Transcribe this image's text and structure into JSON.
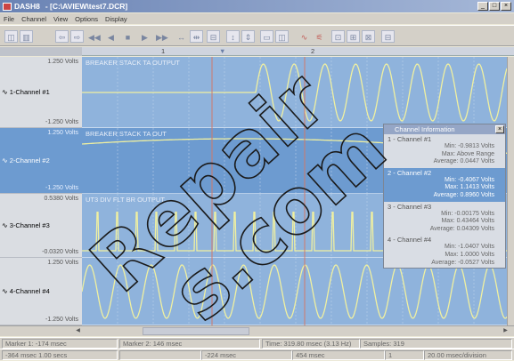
{
  "window": {
    "app_name": "DASH8",
    "document_path": "- [C:\\AVIEW\\test7.DCR]",
    "buttons": {
      "minimize": "_",
      "maximize": "□",
      "close": "×"
    }
  },
  "menu": [
    "File",
    "Channel",
    "View",
    "Options",
    "Display"
  ],
  "toolbar": [
    {
      "name": "marker-icon",
      "glyph": "◫"
    },
    {
      "name": "grid-icon",
      "glyph": "▥"
    },
    {
      "name": "scroll-left-icon",
      "glyph": "⇦"
    },
    {
      "name": "scroll-right-icon",
      "glyph": "⇨"
    },
    {
      "name": "rewind-icon",
      "glyph": "◀◀"
    },
    {
      "name": "step-back-icon",
      "glyph": "◀"
    },
    {
      "name": "stop-icon",
      "glyph": "■"
    },
    {
      "name": "play-icon",
      "glyph": "▶"
    },
    {
      "name": "fast-forward-icon",
      "glyph": "▶▶"
    },
    {
      "name": "zoom-time-out-icon",
      "glyph": "↔"
    },
    {
      "name": "zoom-time-in-icon",
      "glyph": "⇹"
    },
    {
      "name": "fit-icon",
      "glyph": "⊟"
    },
    {
      "name": "zoom-amp-out-icon",
      "glyph": "↕"
    },
    {
      "name": "zoom-amp-in-icon",
      "glyph": "⇕"
    },
    {
      "name": "window-single-icon",
      "glyph": "▭"
    },
    {
      "name": "window-split-icon",
      "glyph": "◫"
    },
    {
      "name": "waveform-icon",
      "glyph": "∿"
    },
    {
      "name": "filter-icon",
      "glyph": "⚟"
    },
    {
      "name": "export-icon",
      "glyph": "⊡"
    },
    {
      "name": "print-icon",
      "glyph": "⊞"
    },
    {
      "name": "copy-icon",
      "glyph": "⊠"
    },
    {
      "name": "info-icon",
      "glyph": "⊟"
    }
  ],
  "ruler": {
    "marker1": "1",
    "marker2": "2",
    "marker_symbol": "▼"
  },
  "channels": [
    {
      "label": "1-Channel #1",
      "scale_top": "1.250 Volts",
      "scale_bottom": "-1.250 Volts",
      "trace_title": "BREAKER STACK TA OUTPUT",
      "selected": false
    },
    {
      "label": "2-Channel #2",
      "scale_top": "1.250 Volts",
      "scale_bottom": "-1.250 Volts",
      "trace_title": "BREAKER STACK TA OUT",
      "selected": true
    },
    {
      "label": "3-Channel #3",
      "scale_top": "0.5380 Volts",
      "scale_bottom": "-0.0320 Volts",
      "trace_title": "UT3 DIV FLT BR OUTPUT",
      "selected": false
    },
    {
      "label": "4-Channel #4",
      "scale_top": "1.250 Volts",
      "scale_bottom": "-1.250 Volts",
      "trace_title": "",
      "selected": false
    }
  ],
  "channel_info": {
    "title": "Channel Information",
    "close_glyph": "×",
    "channels": [
      {
        "name": "1 - Channel #1",
        "lines": [
          "Min: -0.9813 Volts",
          "Max: Above Range",
          "Average: 0.0447 Volts"
        ],
        "selected": false
      },
      {
        "name": "2 - Channel #2",
        "lines": [
          "Min: -0.4067 Volts",
          "Max: 1.1413 Volts",
          "Average: 0.8960 Volts"
        ],
        "selected": true
      },
      {
        "name": "3 - Channel #3",
        "lines": [
          "Min: -0.00175 Volts",
          "Max: 0.43464 Volts",
          "Average: 0.04309 Volts"
        ],
        "selected": false
      },
      {
        "name": "4 - Channel #4",
        "lines": [
          "Min: -1.0407 Volts",
          "Max: 1.0000 Volts",
          "Average: -0.0527 Volts"
        ],
        "selected": false
      }
    ]
  },
  "status1": {
    "marker1": "Marker 1: -174 msec",
    "marker2": "Marker 2: 146 msec",
    "time": "Time: 319.80 msec (3.13 Hz)",
    "samples": "Samples: 319"
  },
  "status2": {
    "range": "-364 msec    1.00 secs",
    "left": "-224 msec",
    "right": "454 msec",
    "page": "1",
    "division": "20.00 msec/division"
  },
  "watermark": {
    "line1": "Repair",
    "line2": "s.com"
  },
  "colors": {
    "plot_bg": "#8fb3dc",
    "selected": "#6d9bd0",
    "trace": "#f0f0a0",
    "marker_line": "#d07a6a"
  }
}
